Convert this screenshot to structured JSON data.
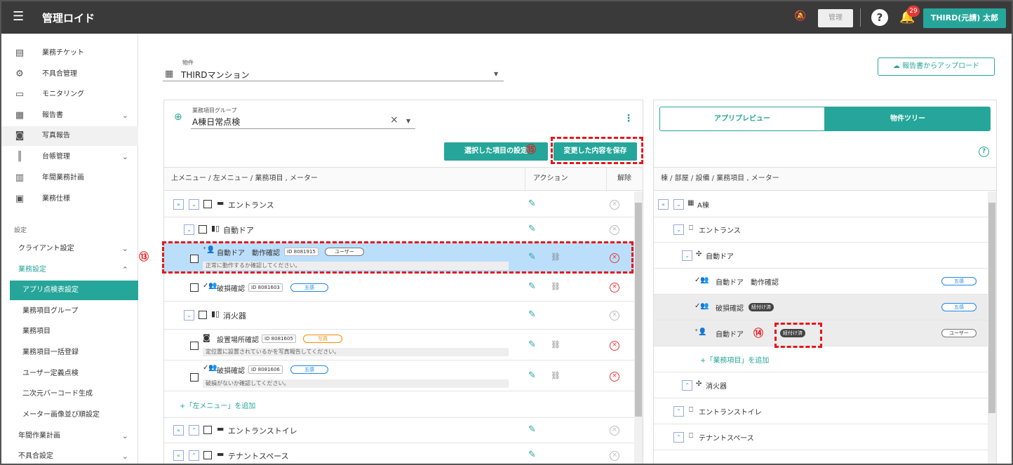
{
  "app": {
    "title": "管理ロイド",
    "menu_icon": "hamburger-icon"
  },
  "topbar": {
    "admin_label": "管理",
    "notification_count": "29",
    "user_label": "THIRD(元請) 太郎"
  },
  "sidebar": {
    "items": [
      {
        "label": "業務チケット",
        "icon": "ticket-icon"
      },
      {
        "label": "不具合管理",
        "icon": "gear-icon"
      },
      {
        "label": "モニタリング",
        "icon": "monitor-icon"
      },
      {
        "label": "報告書",
        "icon": "document-icon"
      },
      {
        "label": "写真報告",
        "icon": "camera-icon"
      },
      {
        "label": "台帳管理",
        "icon": "books-icon"
      },
      {
        "label": "年間業務計画",
        "icon": "calendar-icon"
      },
      {
        "label": "業務仕様",
        "icon": "clipboard-icon"
      }
    ],
    "section_label": "設定",
    "client_settings": "クライアント設定",
    "work_settings": "業務設定",
    "sub_items": [
      "アプリ点検表設定",
      "業務項目グループ",
      "業務項目",
      "業務項目一括登録",
      "ユーザー定義点検",
      "二次元バーコード生成",
      "メーター画像並び順設定"
    ],
    "annual_plan": "年間作業計画",
    "defect_settings": "不具合設定"
  },
  "property": {
    "label": "物件",
    "value": "THIRDマンション"
  },
  "upload_button": "報告書からアップロード",
  "group": {
    "label": "業務項目グループ",
    "value": "A棟日常点検",
    "clear": "×"
  },
  "buttons": {
    "set_selected": "選択した項目の設定",
    "save_changes": "変更した内容を保存"
  },
  "annotations": {
    "n13": "⑬",
    "n14": "⑭",
    "n15": "⑮"
  },
  "left_header": {
    "breadcrumb": "上メニュー / 左メニュー / 業務項目 , メーター",
    "action": "アクション",
    "remove": "解除"
  },
  "left_rows": {
    "entrance": "エントランス",
    "auto_door": "自動ドア",
    "item1": {
      "name": "自動ドア　動作確認",
      "id": "ID 8081915",
      "tag": "ユーザー",
      "desc": "正常に動作するか確認してください。"
    },
    "item2": {
      "name": "破損確認",
      "id": "ID 8081603",
      "tag": "五感"
    },
    "extinguisher": "消火器",
    "item3": {
      "name": "設置場所確認",
      "id": "ID 8081605",
      "tag": "写真",
      "desc": "定位置に設置されているかを写真報告してください。"
    },
    "item4": {
      "name": "破損確認",
      "id": "ID 8081606",
      "tag": "五感",
      "desc": "破損がないか確認してください。"
    },
    "add_left_menu": "+「左メニュー」を追加",
    "entrance_toilet": "エントランストイレ",
    "tenant_space": "テナントスペース"
  },
  "right": {
    "tabs": [
      "アプリプレビュー",
      "物件ツリー"
    ],
    "header": "棟 / 部屋 / 設備 / 業務項目 , メーター",
    "building": "A棟",
    "entrance": "エントランス",
    "auto_door": "自動ドア",
    "r1": {
      "name": "自動ドア　動作確認",
      "tag": "五感"
    },
    "r2": {
      "name": "破損確認",
      "linked": "紐付け済",
      "tag": "五感"
    },
    "r3": {
      "name": "自動ドア",
      "linked": "紐付け済",
      "tag": "ユーザー"
    },
    "add_item": "+「業務項目」を追加",
    "extinguisher": "消火器",
    "entrance_toilet": "エントランストイレ",
    "tenant_space": "テナントスペース"
  }
}
